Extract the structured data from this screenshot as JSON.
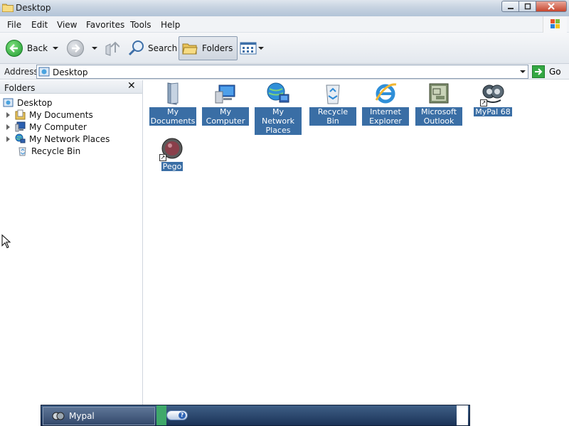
{
  "window": {
    "title": "Desktop",
    "icons": {
      "app": "folder-icon",
      "min": "minimize-icon",
      "max": "maximize-icon",
      "close": "close-icon"
    }
  },
  "menubar": {
    "items": [
      "File",
      "Edit",
      "View",
      "Favorites",
      "Tools",
      "Help"
    ]
  },
  "toolbar": {
    "back_label": "Back",
    "search_label": "Search",
    "folders_label": "Folders"
  },
  "address": {
    "label": "Address",
    "value": "Desktop",
    "go_label": "Go"
  },
  "folders_pane": {
    "title": "Folders",
    "close_glyph": "✕",
    "tree": [
      {
        "label": "Desktop",
        "icon": "desktop-icon",
        "expander": false
      },
      {
        "label": "My Documents",
        "icon": "documents-folder-icon",
        "expander": true
      },
      {
        "label": "My Computer",
        "icon": "computer-icon",
        "expander": true
      },
      {
        "label": "My Network Places",
        "icon": "network-icon",
        "expander": true
      },
      {
        "label": "Recycle Bin",
        "icon": "recycle-bin-icon",
        "expander": false
      }
    ]
  },
  "desktop_items": [
    {
      "label": "My Documents",
      "icon": "documents-folder-icon",
      "shortcut": false
    },
    {
      "label": "My Computer",
      "icon": "computer-icon",
      "shortcut": false
    },
    {
      "label": "My Network Places",
      "icon": "network-icon",
      "shortcut": false
    },
    {
      "label": "Recycle Bin",
      "icon": "recycle-bin-icon",
      "shortcut": false
    },
    {
      "label": "Internet Explorer",
      "icon": "internet-explorer-icon",
      "shortcut": false
    },
    {
      "label": "Microsoft Outlook",
      "icon": "outlook-icon",
      "shortcut": false
    },
    {
      "label": "MyPal 68",
      "icon": "mypal-icon",
      "shortcut": true
    },
    {
      "label": "Pego",
      "icon": "pego-icon",
      "shortcut": true
    }
  ],
  "taskbar": {
    "task_label": "Mypal",
    "help_glyph": "?"
  },
  "colors": {
    "selection": "#3a6ea5",
    "taskbar": "#1b3358"
  }
}
